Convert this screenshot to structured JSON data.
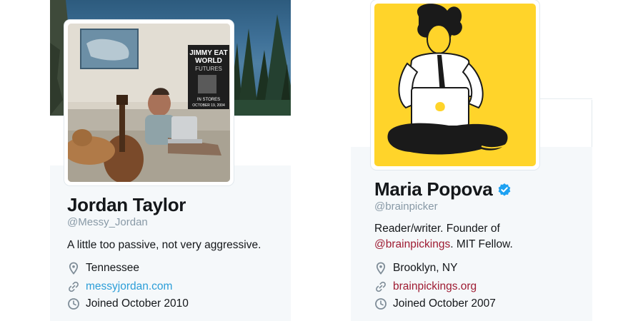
{
  "profiles": [
    {
      "name": "Jordan Taylor",
      "handle": "@Messy_Jordan",
      "bio": "A little too passive, not very aggressive.",
      "location": "Tennessee",
      "website": "messyjordan.com",
      "joined": "Joined October 2010",
      "poster_text": [
        "JIMMY EAT",
        "WORLD",
        "FUTURES",
        "IN STORES",
        "OCTOBER 19, 2004"
      ]
    },
    {
      "name": "Maria Popova",
      "verified": true,
      "handle": "@brainpicker",
      "bio_line1": "Reader/writer. Founder of",
      "bio_mention": "@brainpickings",
      "bio_line2_rest": ". MIT Fellow.",
      "location": "Brooklyn, NY",
      "website": "brainpickings.org",
      "joined": "Joined October 2007"
    }
  ],
  "icons": {
    "location": "location-pin-icon",
    "website": "link-icon",
    "joined": "clock-icon",
    "verified": "verified-badge-icon"
  },
  "colors": {
    "name_text": "#14171a",
    "handle_text": "#8899a6",
    "link_blue": "#2c9ed8",
    "link_red": "#9e1b32",
    "verified_blue": "#1da1f2",
    "avatar_yellow": "#ffd42a"
  }
}
